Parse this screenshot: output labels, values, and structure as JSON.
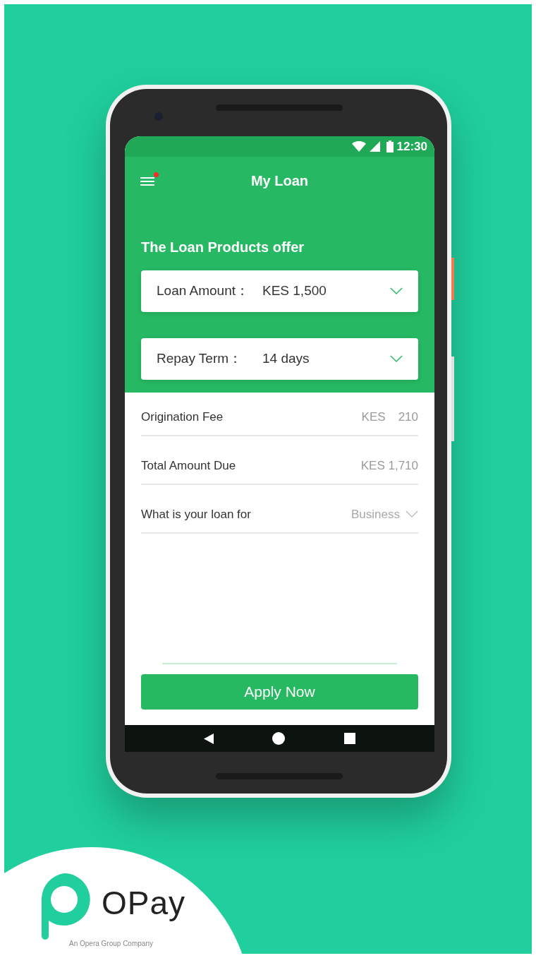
{
  "status_bar": {
    "time": "12:30"
  },
  "header": {
    "title": "My Loan",
    "menu_badge": true
  },
  "offer": {
    "title": "The Loan Products offer",
    "selectors": [
      {
        "label": "Loan Amount：",
        "value": "KES 1,500"
      },
      {
        "label": "Repay Term：",
        "value": "14 days"
      }
    ]
  },
  "details": [
    {
      "kind": "split",
      "label": "Origination Fee",
      "currency": "KES",
      "amount": "210"
    },
    {
      "kind": "value",
      "label": "Total Amount Due",
      "value": "KES 1,710"
    },
    {
      "kind": "select",
      "label": "What is your loan for",
      "value": "Business"
    }
  ],
  "button": "Apply Now",
  "brand": {
    "name": "OPay",
    "tagline": "An Opera Group Company"
  }
}
